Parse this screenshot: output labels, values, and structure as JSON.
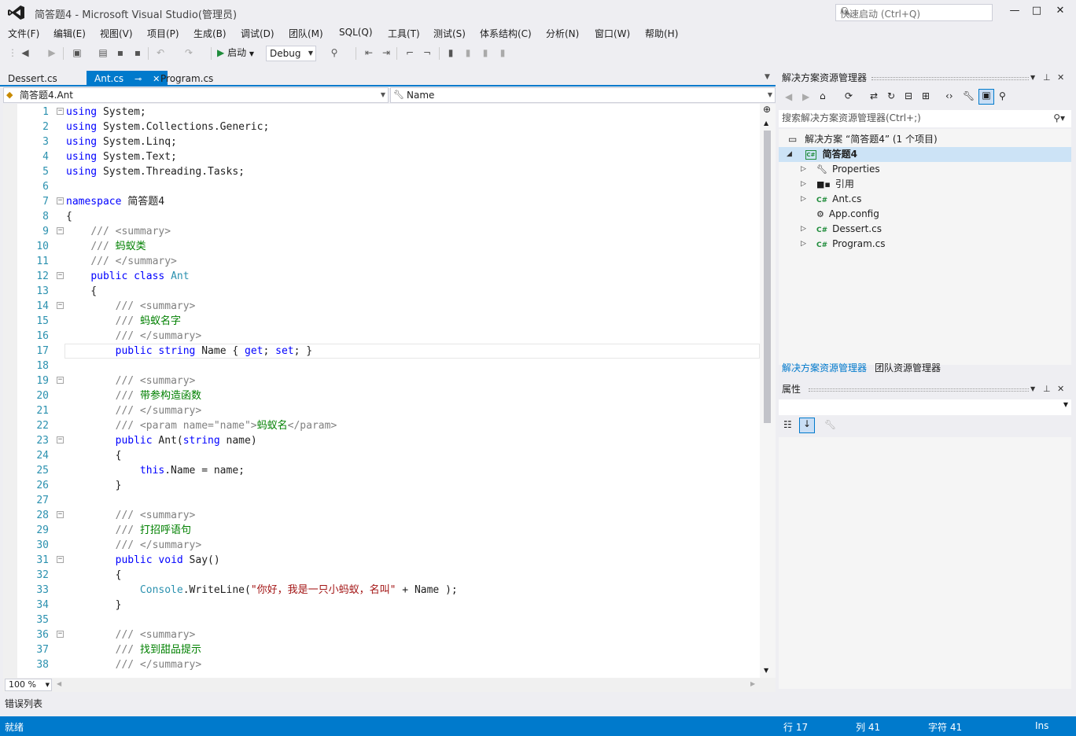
{
  "window": {
    "title": "简答题4 - Microsoft Visual Studio(管理员)",
    "quick_launch_placeholder": "快速启动 (Ctrl+Q)",
    "minimize": "—",
    "maximize": "□",
    "close": "✕"
  },
  "menu": [
    "文件(F)",
    "编辑(E)",
    "视图(V)",
    "项目(P)",
    "生成(B)",
    "调试(D)",
    "团队(M)",
    "SQL(Q)",
    "工具(T)",
    "测试(S)",
    "体系结构(C)",
    "分析(N)",
    "窗口(W)",
    "帮助(H)"
  ],
  "toolbar": {
    "start_label": "启动",
    "config": "Debug"
  },
  "editor_tabs": [
    {
      "label": "Dessert.cs",
      "active": false
    },
    {
      "label": "Ant.cs",
      "active": true
    },
    {
      "label": "Program.cs",
      "active": false
    }
  ],
  "nav": {
    "type_selector": "简答题4.Ant",
    "member_selector": "Name"
  },
  "code_lines": [
    {
      "n": "1",
      "html": "<span class='kw'>using</span> System;",
      "fold": "-"
    },
    {
      "n": "2",
      "html": "<span class='kw'>using</span> System.Collections.Generic;",
      "fold": ""
    },
    {
      "n": "3",
      "html": "<span class='kw'>using</span> System.Linq;",
      "fold": ""
    },
    {
      "n": "4",
      "html": "<span class='kw'>using</span> System.Text;",
      "fold": ""
    },
    {
      "n": "5",
      "html": "<span class='kw'>using</span> System.Threading.Tasks;",
      "fold": ""
    },
    {
      "n": "6",
      "html": "",
      "fold": ""
    },
    {
      "n": "7",
      "html": "<span class='kw'>namespace</span> 简答题4",
      "fold": "-"
    },
    {
      "n": "8",
      "html": "{",
      "fold": ""
    },
    {
      "n": "9",
      "html": "    <span class='gr'>///</span> <span class='gr'>&lt;summary&gt;</span>",
      "fold": "-"
    },
    {
      "n": "10",
      "html": "    <span class='gr'>///</span> <span class='cm'>蚂蚁类</span>",
      "fold": ""
    },
    {
      "n": "11",
      "html": "    <span class='gr'>/// &lt;/summary&gt;</span>",
      "fold": ""
    },
    {
      "n": "12",
      "html": "    <span class='kw'>public</span> <span class='kw'>class</span> <span class='ty'>Ant</span>",
      "fold": "-"
    },
    {
      "n": "13",
      "html": "    {",
      "fold": ""
    },
    {
      "n": "14",
      "html": "        <span class='gr'>/// &lt;summary&gt;</span>",
      "fold": "-"
    },
    {
      "n": "15",
      "html": "        <span class='gr'>///</span> <span class='cm'>蚂蚁名字</span>",
      "fold": ""
    },
    {
      "n": "16",
      "html": "        <span class='gr'>/// &lt;/summary&gt;</span>",
      "fold": ""
    },
    {
      "n": "17",
      "html": "        <span class='kw'>public</span> <span class='kw'>string</span> Name { <span class='kw'>get</span>; <span class='kw'>set</span>; }",
      "fold": ""
    },
    {
      "n": "18",
      "html": "",
      "fold": ""
    },
    {
      "n": "19",
      "html": "        <span class='gr'>/// &lt;summary&gt;</span>",
      "fold": "-"
    },
    {
      "n": "20",
      "html": "        <span class='gr'>///</span> <span class='cm'>带参构造函数</span>",
      "fold": ""
    },
    {
      "n": "21",
      "html": "        <span class='gr'>/// &lt;/summary&gt;</span>",
      "fold": ""
    },
    {
      "n": "22",
      "html": "        <span class='gr'>/// &lt;param name=\"name\"&gt;</span><span class='cm'>蚂蚁名</span><span class='gr'>&lt;/param&gt;</span>",
      "fold": ""
    },
    {
      "n": "23",
      "html": "        <span class='kw'>public</span> Ant(<span class='kw'>string</span> name)",
      "fold": "-"
    },
    {
      "n": "24",
      "html": "        {",
      "fold": ""
    },
    {
      "n": "25",
      "html": "            <span class='kw'>this</span>.Name = name;",
      "fold": ""
    },
    {
      "n": "26",
      "html": "        }",
      "fold": ""
    },
    {
      "n": "27",
      "html": "",
      "fold": ""
    },
    {
      "n": "28",
      "html": "        <span class='gr'>/// &lt;summary&gt;</span>",
      "fold": "-"
    },
    {
      "n": "29",
      "html": "        <span class='gr'>///</span> <span class='cm'>打招呼语句</span>",
      "fold": ""
    },
    {
      "n": "30",
      "html": "        <span class='gr'>/// &lt;/summary&gt;</span>",
      "fold": ""
    },
    {
      "n": "31",
      "html": "        <span class='kw'>public</span> <span class='kw'>void</span> Say()",
      "fold": "-"
    },
    {
      "n": "32",
      "html": "        {",
      "fold": ""
    },
    {
      "n": "33",
      "html": "            <span class='ty'>Console</span>.WriteLine(<span class='st'>\"你好，我是一只小蚂蚁，名叫\"</span> + Name );",
      "fold": ""
    },
    {
      "n": "34",
      "html": "        }",
      "fold": ""
    },
    {
      "n": "35",
      "html": "",
      "fold": ""
    },
    {
      "n": "36",
      "html": "        <span class='gr'>/// &lt;summary&gt;</span>",
      "fold": "-"
    },
    {
      "n": "37",
      "html": "        <span class='gr'>///</span> <span class='cm'>找到甜品提示</span>",
      "fold": ""
    },
    {
      "n": "38",
      "html": "        <span class='gr'>/// &lt;/summary&gt;</span>",
      "fold": ""
    }
  ],
  "zoom": "100 %",
  "error_list_label": "错误列表",
  "status": {
    "ready": "就绪",
    "line": "行 17",
    "col": "列 41",
    "ch": "字符 41",
    "mode": "Ins"
  },
  "solution_explorer": {
    "title": "解决方案资源管理器",
    "search_placeholder": "搜索解决方案资源管理器(Ctrl+;)",
    "solution_label": "解决方案 “简答题4” (1 个项目)",
    "project": "简答题4",
    "items": [
      {
        "label": "Properties",
        "icon": "wrench-icon",
        "expandable": true
      },
      {
        "label": "引用",
        "icon": "references-icon",
        "expandable": true
      },
      {
        "label": "Ant.cs",
        "icon": "csharp-file-icon",
        "expandable": true
      },
      {
        "label": "App.config",
        "icon": "config-file-icon",
        "expandable": false
      },
      {
        "label": "Dessert.cs",
        "icon": "csharp-file-icon",
        "expandable": true
      },
      {
        "label": "Program.cs",
        "icon": "csharp-file-icon",
        "expandable": true
      }
    ],
    "tab_solution": "解决方案资源管理器",
    "tab_team": "团队资源管理器"
  },
  "properties": {
    "title": "属性"
  },
  "colors": {
    "accent": "#007acc",
    "keyword": "#0000ff",
    "comment": "#008000",
    "type": "#2b91af",
    "string": "#a31515"
  }
}
